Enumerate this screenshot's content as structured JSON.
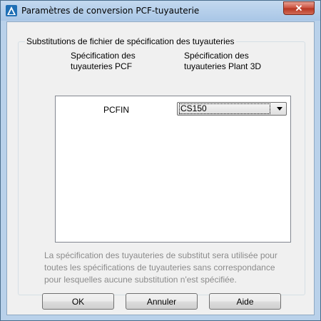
{
  "window": {
    "title": "Paramètres de conversion PCF-tuyauterie",
    "icon": "autocad-triangle-icon",
    "close_label": "✕"
  },
  "group": {
    "legend": "Substitutions de fichier de spécification des tuyauteries",
    "col_left_line1": "Spécification des",
    "col_left_line2": "tuyauteries PCF",
    "col_right_line1": "Spécification des",
    "col_right_line2": "tuyauteries Plant 3D"
  },
  "rows": [
    {
      "pcf": "PCFIN",
      "plant3d": "CS150"
    }
  ],
  "note": "La spécification des tuyauteries de substitut sera utilisée pour toutes les spécifications de tuyauteries sans correspondance pour lesquelles aucune substitution n'est spécifiée.",
  "buttons": {
    "ok": "OK",
    "cancel": "Annuler",
    "help": "Aide"
  },
  "colors": {
    "title_bar": "#b9d1ea",
    "close_button": "#c94d3a",
    "note_text": "#8b8b8b"
  }
}
